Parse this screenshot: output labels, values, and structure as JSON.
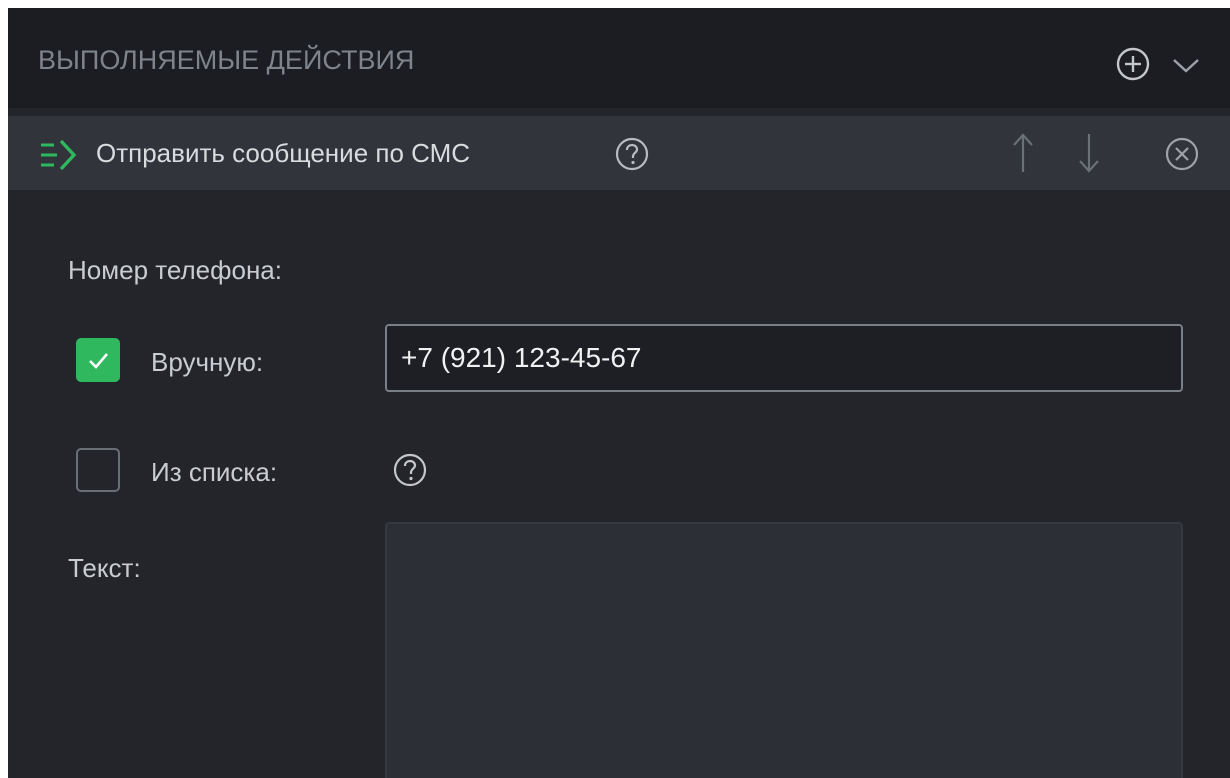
{
  "section": {
    "title": "ВЫПОЛНЯЕМЫЕ ДЕЙСТВИЯ",
    "add_icon": "plus-circle-icon",
    "collapse_icon": "chevron-down-icon"
  },
  "action": {
    "icon": "action-arrow-icon",
    "title": "Отправить сообщение по СМС",
    "help_icon": "question-circle-icon",
    "move_up_icon": "arrow-up-icon",
    "move_down_icon": "arrow-down-icon",
    "remove_icon": "close-circle-icon"
  },
  "form": {
    "phone_label": "Номер телефона:",
    "manual": {
      "label": "Вручную:",
      "checked": true,
      "value": "+7 (921) 123-45-67"
    },
    "from_list": {
      "label": "Из списка:",
      "checked": false,
      "help_icon": "question-circle-icon"
    },
    "text_label": "Текст:",
    "text_value": ""
  },
  "colors": {
    "accent_green": "#2fb85d",
    "panel_bg": "#23252b",
    "header_bg": "#1b1d22",
    "action_bar_bg": "#31343b"
  }
}
